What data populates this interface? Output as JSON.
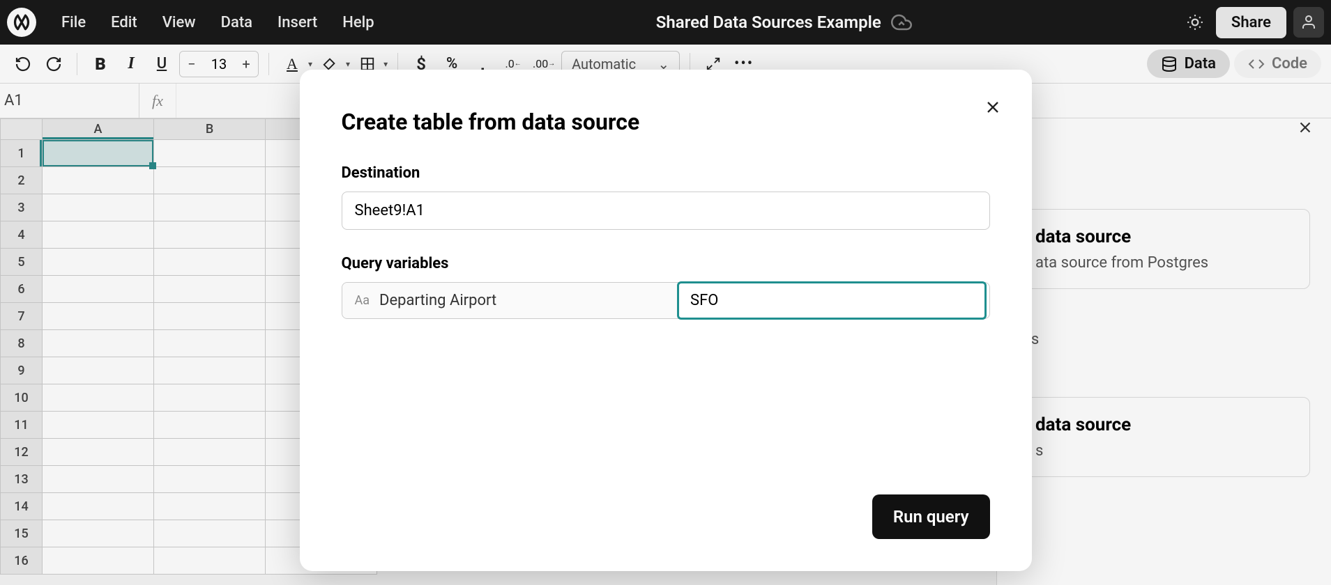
{
  "menubar": {
    "items": [
      "File",
      "Edit",
      "View",
      "Data",
      "Insert",
      "Help"
    ],
    "doc_title": "Shared Data Sources Example",
    "share_label": "Share"
  },
  "toolbar": {
    "font_size": "13",
    "number_format": "Automatic",
    "data_tab": "Data",
    "code_tab": "Code"
  },
  "formula_bar": {
    "cell_ref": "A1",
    "fx": "fx"
  },
  "grid": {
    "columns": [
      "A",
      "B"
    ],
    "rows": [
      "1",
      "2",
      "3",
      "4",
      "5",
      "6",
      "7",
      "8",
      "9",
      "10",
      "11",
      "12",
      "13",
      "14",
      "15",
      "16"
    ],
    "selected_cell_value": ""
  },
  "side_panel": {
    "card1_title": "data source",
    "card1_text": "ata source from Postgres",
    "card2_title_suffix": "res",
    "card3_title": "data source",
    "card3_text": "s"
  },
  "modal": {
    "title": "Create table from data source",
    "destination_label": "Destination",
    "destination_value": "Sheet9!A1",
    "query_vars_label": "Query variables",
    "var_name": "Departing Airport",
    "var_value": "SFO",
    "run_label": "Run query"
  }
}
